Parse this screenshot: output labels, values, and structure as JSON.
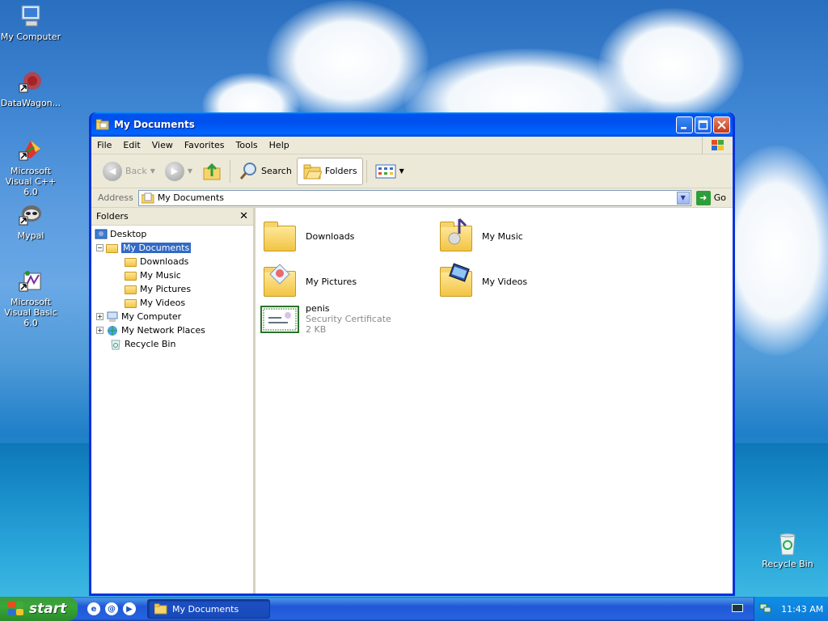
{
  "desktop": {
    "icons": [
      {
        "label": "My Computer"
      },
      {
        "label": "DataWagon..."
      },
      {
        "label": "Microsoft Visual C++ 6.0"
      },
      {
        "label": "Mypal"
      },
      {
        "label": "Microsoft Visual Basic 6.0"
      },
      {
        "label": "Recycle Bin"
      }
    ]
  },
  "window": {
    "title": "My Documents",
    "menu": [
      "File",
      "Edit",
      "View",
      "Favorites",
      "Tools",
      "Help"
    ],
    "toolbar": {
      "back_label": "Back",
      "search_label": "Search",
      "folders_label": "Folders"
    },
    "address": {
      "label": "Address",
      "value": "My Documents",
      "go_label": "Go"
    },
    "folders_pane": {
      "title": "Folders",
      "close_glyph": "✕",
      "tree": [
        {
          "label": "Desktop"
        },
        {
          "label": "My Documents",
          "expander": "−"
        },
        {
          "label": "Downloads"
        },
        {
          "label": "My Music"
        },
        {
          "label": "My Pictures"
        },
        {
          "label": "My Videos"
        },
        {
          "label": "My Computer",
          "expander": "+"
        },
        {
          "label": "My Network Places",
          "expander": "+"
        },
        {
          "label": "Recycle Bin"
        }
      ]
    },
    "items": [
      {
        "name": "Downloads"
      },
      {
        "name": "My Music"
      },
      {
        "name": "My Pictures"
      },
      {
        "name": "My Videos"
      },
      {
        "name": "penis",
        "type": "Security Certificate",
        "size": "2 KB"
      }
    ]
  },
  "taskbar": {
    "start_label": "start",
    "task_label": "My Documents",
    "clock": "11:43 AM"
  },
  "colors": {
    "titlebar": "#0053ee",
    "selection": "#316ac5",
    "start_green": "#37a737",
    "chrome": "#ece9d8"
  }
}
